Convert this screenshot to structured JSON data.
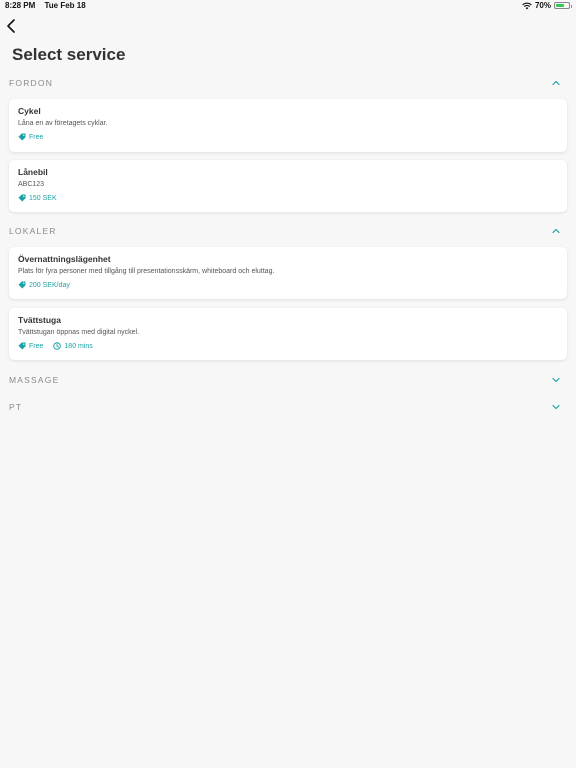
{
  "status_bar": {
    "time": "8:28 PM",
    "date": "Tue Feb 18",
    "battery": "70%",
    "battery_level": 0.7
  },
  "header": {
    "title": "Select service"
  },
  "colors": {
    "accent": "#1aa3a6",
    "section_text": "#8a8a8a",
    "background": "#f7f7f7"
  },
  "sections": {
    "fordon": {
      "title": "FORDON",
      "expanded": true,
      "items": [
        {
          "title": "Cykel",
          "description": "Låna en av företagets cyklar.",
          "price": "Free"
        },
        {
          "title": "Lånebil",
          "description": "ABC123",
          "price": "150 SEK"
        }
      ]
    },
    "lokaler": {
      "title": "LOKALER",
      "expanded": true,
      "items": [
        {
          "title": "Övernattningslägenhet",
          "description": "Plats för fyra personer med tillgång till presentationsskärm, whiteboard och eluttag.",
          "price": "200 SEK/day"
        },
        {
          "title": "Tvättstuga",
          "description": "Tvättstugan öppnas med digital nyckel.",
          "price": "Free",
          "duration": "180 mins"
        }
      ]
    },
    "massage": {
      "title": "MASSAGE",
      "expanded": false
    },
    "pt": {
      "title": "PT",
      "expanded": false
    }
  }
}
